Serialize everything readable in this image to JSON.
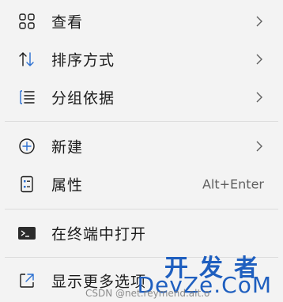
{
  "menu": {
    "items": [
      {
        "label": "查看",
        "icon": "grid-icon",
        "submenu": true
      },
      {
        "label": "排序方式",
        "icon": "sort-icon",
        "submenu": true
      },
      {
        "label": "分组依据",
        "icon": "group-by-icon",
        "submenu": true
      },
      {
        "label": "新建",
        "icon": "new-plus-icon",
        "submenu": true
      },
      {
        "label": "属性",
        "icon": "properties-icon",
        "shortcut": "Alt+Enter"
      },
      {
        "label": "在终端中打开",
        "icon": "terminal-icon"
      },
      {
        "label": "显示更多选项",
        "icon": "more-options-icon"
      }
    ]
  },
  "watermark": {
    "cn": "开发者",
    "en": "DevZe.CoM",
    "csdn": "CSDN @net.reymend.alt.o"
  },
  "colors": {
    "background": "#f3f3f3",
    "text": "#1b1b1b",
    "icon": "#1b1b1b",
    "accent_icon": "#2a6fd1",
    "watermark": "#1f5fbf"
  }
}
